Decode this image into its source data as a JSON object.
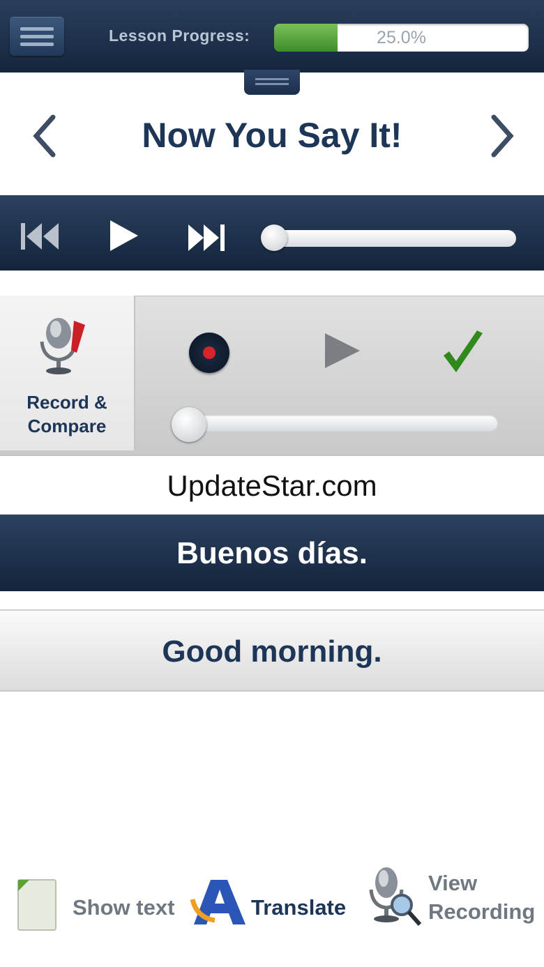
{
  "header": {
    "progress_label": "Lesson Progress:",
    "progress_value": 0.25,
    "progress_text": "25.0%"
  },
  "lesson": {
    "title": "Now You Say It!"
  },
  "record": {
    "label_line1": "Record &",
    "label_line2": "Compare"
  },
  "watermark": "UpdateStar.com",
  "phrase": {
    "target": "Buenos días.",
    "translation": "Good morning."
  },
  "toolbar": {
    "show_text": "Show text",
    "translate": "Translate",
    "view_line1": "View",
    "view_line2": "Recording"
  },
  "colors": {
    "navy": "#1d3557",
    "progress_green": "#4f9f36",
    "record_red": "#d8232a",
    "check_green": "#2f8a1b"
  }
}
